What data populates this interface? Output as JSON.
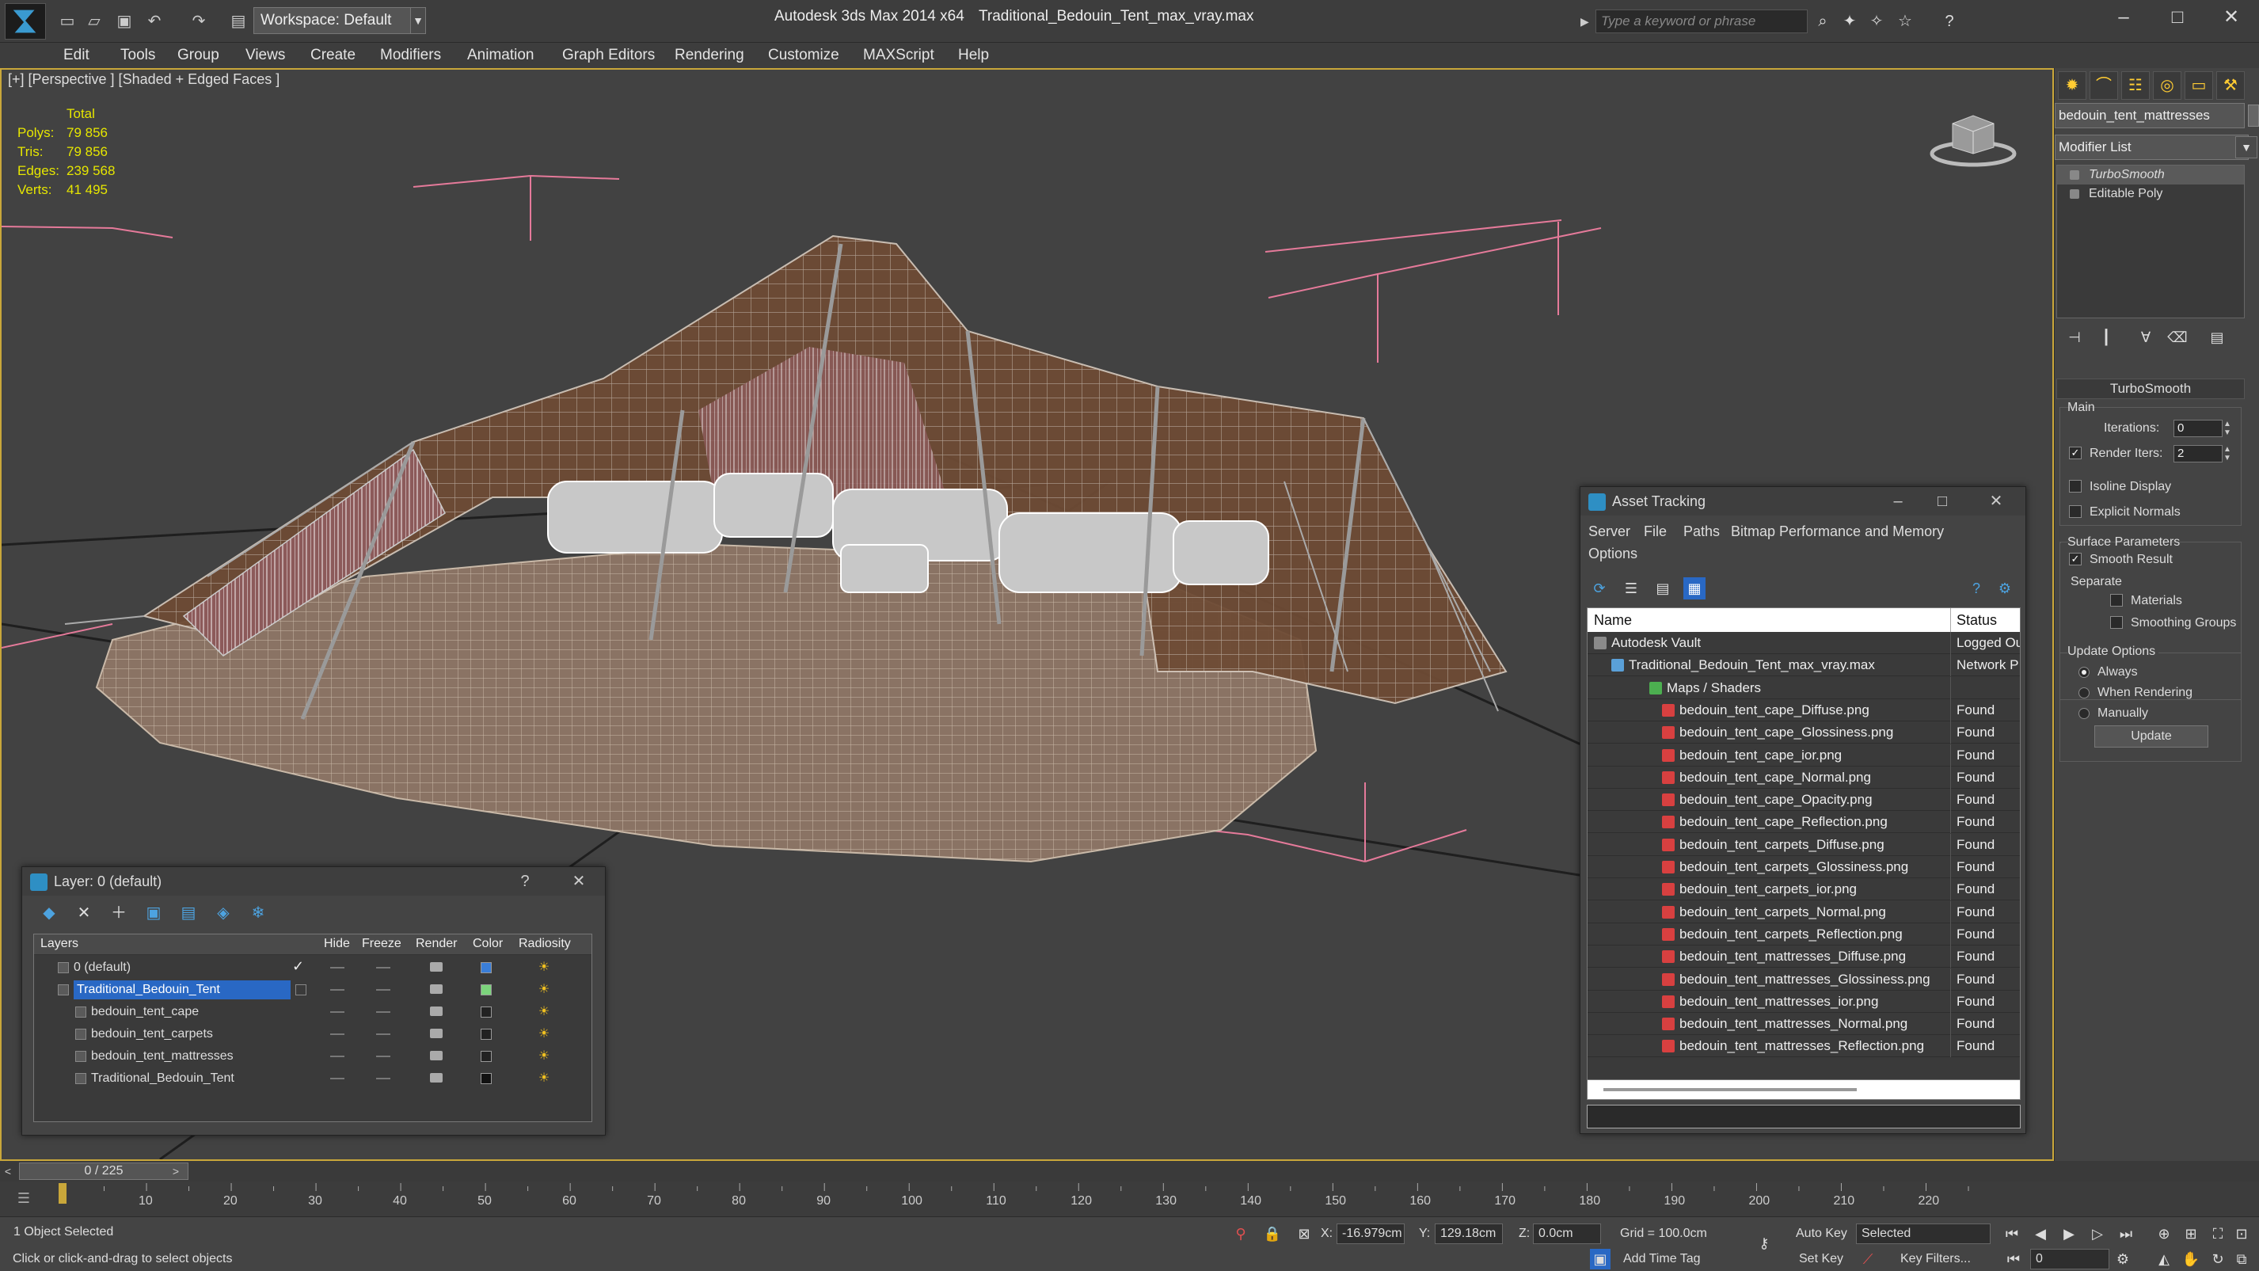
{
  "app": {
    "title": "Autodesk 3ds Max  2014 x64",
    "file": "Traditional_Bedouin_Tent_max_vray.max",
    "workspace": "Workspace: Default",
    "search_placeholder": "Type a keyword or phrase"
  },
  "menu": [
    "Edit",
    "Tools",
    "Group",
    "Views",
    "Create",
    "Modifiers",
    "Animation",
    "Graph Editors",
    "Rendering",
    "Customize",
    "MAXScript",
    "Help"
  ],
  "viewport": {
    "label": "[+] [Perspective ] [Shaded + Edged Faces ]",
    "stats": {
      "header": "Total",
      "rows": [
        {
          "k": "Polys:",
          "v": "79 856"
        },
        {
          "k": "Tris:",
          "v": "79 856"
        },
        {
          "k": "Edges:",
          "v": "239 568"
        },
        {
          "k": "Verts:",
          "v": "41 495"
        }
      ]
    }
  },
  "command_panel": {
    "object_name": "bedouin_tent_mattresses",
    "modifier_list": "Modifier List",
    "stack": [
      "TurboSmooth",
      "Editable Poly"
    ],
    "rollout": "TurboSmooth",
    "main_label": "Main",
    "iterations_label": "Iterations:",
    "iterations": "0",
    "render_iters_label": "Render Iters:",
    "render_iters": "2",
    "isoline": "Isoline Display",
    "explicit_normals": "Explicit Normals",
    "surface_params": "Surface Parameters",
    "smooth_result": "Smooth Result",
    "separate": "Separate",
    "materials": "Materials",
    "smoothing_groups": "Smoothing Groups",
    "update_options": "Update Options",
    "always": "Always",
    "when_rendering": "When Rendering",
    "manually": "Manually",
    "update": "Update"
  },
  "layer_window": {
    "title": "Layer: 0 (default)",
    "help": "?",
    "columns": [
      "Layers",
      "Hide",
      "Freeze",
      "Render",
      "Color",
      "Radiosity"
    ],
    "rows": [
      {
        "name": "0 (default)",
        "color": "#3a7ed8"
      },
      {
        "name": "Traditional_Bedouin_Tent",
        "color": "#7cd47c"
      },
      {
        "name": "bedouin_tent_cape",
        "color": "#222222"
      },
      {
        "name": "bedouin_tent_carpets",
        "color": "#222222"
      },
      {
        "name": "bedouin_tent_mattresses",
        "color": "#222222"
      },
      {
        "name": "Traditional_Bedouin_Tent",
        "color": "#111111"
      }
    ]
  },
  "asset_window": {
    "title": "Asset Tracking",
    "menu": [
      "Server",
      "File",
      "Paths",
      "Bitmap Performance and Memory",
      "Options"
    ],
    "col_name": "Name",
    "col_status": "Status",
    "rows": [
      {
        "name": "Autodesk Vault",
        "status": "Logged Ou"
      },
      {
        "name": "Traditional_Bedouin_Tent_max_vray.max",
        "status": "Network P"
      },
      {
        "name": "Maps / Shaders",
        "status": ""
      },
      {
        "name": "bedouin_tent_cape_Diffuse.png",
        "status": "Found"
      },
      {
        "name": "bedouin_tent_cape_Glossiness.png",
        "status": "Found"
      },
      {
        "name": "bedouin_tent_cape_ior.png",
        "status": "Found"
      },
      {
        "name": "bedouin_tent_cape_Normal.png",
        "status": "Found"
      },
      {
        "name": "bedouin_tent_cape_Opacity.png",
        "status": "Found"
      },
      {
        "name": "bedouin_tent_cape_Reflection.png",
        "status": "Found"
      },
      {
        "name": "bedouin_tent_carpets_Diffuse.png",
        "status": "Found"
      },
      {
        "name": "bedouin_tent_carpets_Glossiness.png",
        "status": "Found"
      },
      {
        "name": "bedouin_tent_carpets_ior.png",
        "status": "Found"
      },
      {
        "name": "bedouin_tent_carpets_Normal.png",
        "status": "Found"
      },
      {
        "name": "bedouin_tent_carpets_Reflection.png",
        "status": "Found"
      },
      {
        "name": "bedouin_tent_mattresses_Diffuse.png",
        "status": "Found"
      },
      {
        "name": "bedouin_tent_mattresses_Glossiness.png",
        "status": "Found"
      },
      {
        "name": "bedouin_tent_mattresses_ior.png",
        "status": "Found"
      },
      {
        "name": "bedouin_tent_mattresses_Normal.png",
        "status": "Found"
      },
      {
        "name": "bedouin_tent_mattresses_Reflection.png",
        "status": "Found"
      }
    ]
  },
  "timeline": {
    "frame": "0 / 225",
    "ticks": [
      "10",
      "20",
      "30",
      "40",
      "50",
      "60",
      "70",
      "80",
      "90",
      "100",
      "110",
      "120",
      "130",
      "140",
      "150",
      "160",
      "170",
      "180",
      "190",
      "200",
      "210",
      "220"
    ]
  },
  "status": {
    "selection": "1 Object Selected",
    "prompt": "Click or click-and-drag to select objects",
    "x_label": "X:",
    "x": "-16.979cm",
    "y_label": "Y:",
    "y": "129.18cm",
    "z_label": "Z:",
    "z": "0.0cm",
    "grid": "Grid = 100.0cm",
    "add_time_tag": "Add Time Tag",
    "auto_key": "Auto Key",
    "set_key": "Set Key",
    "key_mode": "Selected",
    "key_filters": "Key Filters...",
    "frame_field": "0"
  }
}
